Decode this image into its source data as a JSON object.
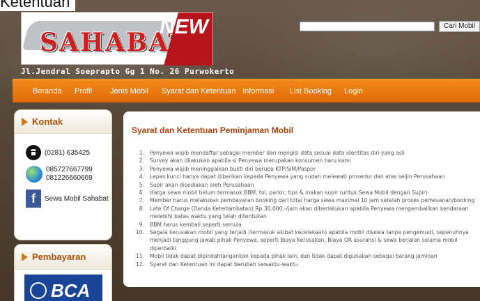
{
  "page": {
    "top_title": "Ketentuan",
    "colors": {
      "nav_orange": "#e8760c",
      "title_brown": "#a8410a",
      "brand_red": "#cc1f1f"
    }
  },
  "header": {
    "logo_text": "SAHABAT",
    "logo_badge": "NEW",
    "address": "Jl.Jendral Soeprapto Gg 1 No. 26 Purwokerto",
    "search": {
      "placeholder": "",
      "value": "",
      "button_label": "Cari Mobil"
    }
  },
  "nav": {
    "items": [
      {
        "label": "Beranda"
      },
      {
        "label": "Profil"
      },
      {
        "label": "Jenis Mobil"
      },
      {
        "label": "Syarat dan Ketentuan"
      },
      {
        "label": "Informasi"
      },
      {
        "label": "List Booking"
      },
      {
        "label": "Login"
      }
    ]
  },
  "sidebar": {
    "contact": {
      "title": "Kontak",
      "phone": "(0281) 635425",
      "mobile_1": "085727667799",
      "mobile_2": "081226660669",
      "facebook_label": "Sewa Mobil Sahabat",
      "icons": [
        "phone-icon",
        "globe-icon",
        "facebook-icon"
      ]
    },
    "payment": {
      "title": "Pembayaran",
      "bank": "BCA"
    }
  },
  "main": {
    "title": "Syarat dan Ketentuan Peminjaman Mobil",
    "terms": [
      {
        "num": "1.",
        "text": "Penyewa wajib mendaftar sebagai member dan mengisi data sesuai data identitas diri yang asli"
      },
      {
        "num": "2.",
        "text": "Survey akan dilakukan apabila si Penyewa merupakan konsumen baru kami"
      },
      {
        "num": "3.",
        "text": "Penyewa wajib meninggalkan bukti diri berupa KTP/SIM/Paspor"
      },
      {
        "num": "4.",
        "text": "Lepas kunci hanya dapat diberikan kepada Penyewa yang sudah melewati prosedur dan atas seijin Perusahaan"
      },
      {
        "num": "5.",
        "text": "Supir akan disediakan oleh Perusahaan"
      },
      {
        "num": "6.",
        "text": "Harga sewa mobil belum termasuk BBM, tol, parkir, tips & makan supir (untuk Sewa Mobil dengan Supir)"
      },
      {
        "num": "7.",
        "text": "Member harus melakukan pembayaran booking dari total harga sewa maximal 10 jam setelah proses pemesanan/booking"
      },
      {
        "num": "8.",
        "text": "Late Of Charge (Denda Keterlambatan) Rp.30.000,-/jam akan diberlakukan apabila Penyewa mengembalikan kendaraan melebihi batas waktu yang telah ditentukan"
      },
      {
        "num": "9.",
        "text": "BBM harus kembali seperti semula"
      },
      {
        "num": "10.",
        "text": "Segala kerusakan mobil yang terjadi (termasuk akibat kecelakaan) apabila mobil disewa tanpa pengemudi, sepenuhnya menjadi tanggung jawab pihak Penyewa, seperti Biaya Kerusakan, Biaya OR asuransi & sewa berjalan selama mobil diperbaiki"
      },
      {
        "num": "11.",
        "text": "Mobil tidak dapat dipindahtangankan kepada pihak lain, dan tidak dapat digunakan sebagai barang jaminan"
      },
      {
        "num": "12.",
        "text": "Syarat dan Ketentuan ini dapat berubah sewaktu-waktu"
      }
    ]
  }
}
